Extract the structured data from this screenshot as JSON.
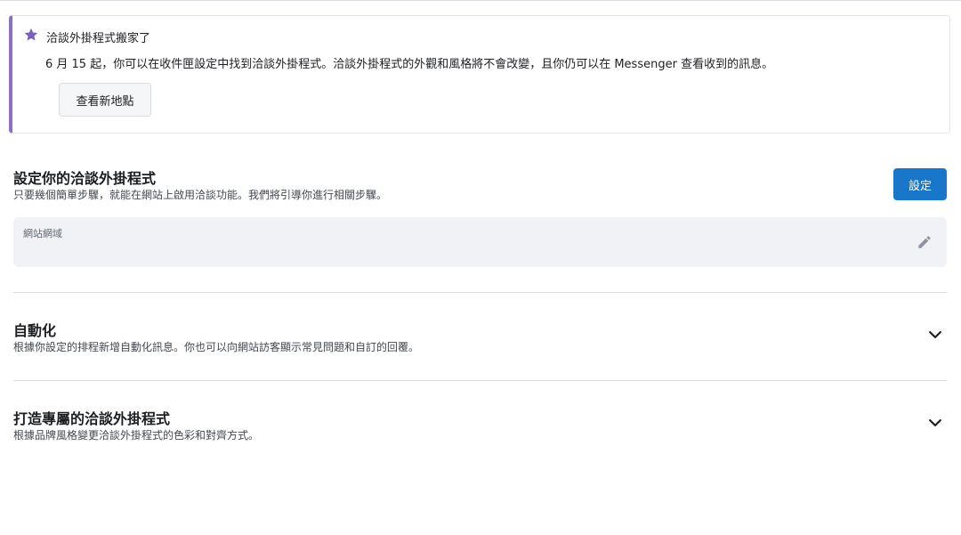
{
  "notice": {
    "title": "洽談外掛程式搬家了",
    "body": "6 月 15 起，你可以在收件匣設定中找到洽談外掛程式。洽談外掛程式的外觀和風格將不會改變，且你仍可以在 Messenger 查看收到的訊息。",
    "button_label": "查看新地點",
    "icon": "star-icon",
    "accent_color": "#8a6fc4"
  },
  "setup": {
    "title": "設定你的洽談外掛程式",
    "description": "只要幾個簡單步驟，就能在網站上啟用洽談功能。我們將引導你進行相關步驟。",
    "button_label": "設定",
    "button_color": "#1877c9",
    "domain_field": {
      "label": "網站網域",
      "value": "",
      "icon": "pencil-icon"
    }
  },
  "automation": {
    "title": "自動化",
    "description": "根據你設定的排程新增自動化訊息。你也可以向網站訪客顯示常見問題和自訂的回覆。",
    "icon": "chevron-down-icon"
  },
  "customize": {
    "title": "打造專屬的洽談外掛程式",
    "description": "根據品牌風格變更洽談外掛程式的色彩和對齊方式。",
    "icon": "chevron-down-icon"
  }
}
